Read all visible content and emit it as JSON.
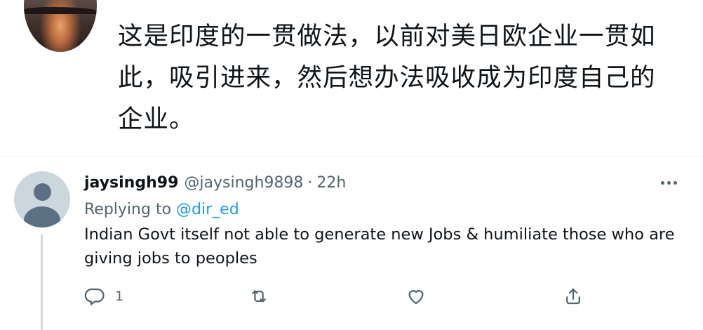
{
  "top_tweet": {
    "text": "这是印度的一贯做法，以前对美日欧企业一贯如此，吸引进来，然后想办法吸收成为印度自己的企业。"
  },
  "reply": {
    "display_name": "jaysingh99",
    "handle": "@jaysingh9898",
    "separator": "·",
    "time": "22h",
    "replying_prefix": "Replying to",
    "replying_to": "@dir_ed",
    "text": "Indian Govt itself not able to generate new Jobs & humiliate those who are giving jobs to peoples",
    "actions": {
      "reply_count": "1",
      "retweet_count": "",
      "like_count": ""
    }
  },
  "colors": {
    "text_primary": "#0f1419",
    "text_secondary": "#536471",
    "accent": "#1d9bf0",
    "divider": "#eff3f4"
  },
  "icons": [
    "more-icon",
    "reply-icon",
    "retweet-icon",
    "like-icon",
    "share-icon"
  ]
}
